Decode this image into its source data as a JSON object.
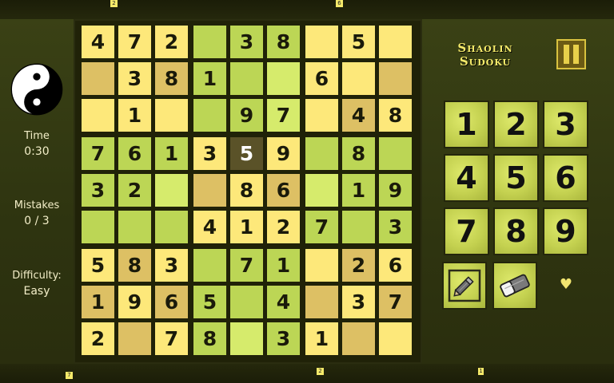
{
  "title_lines": [
    "Shaolin",
    "Sudoku"
  ],
  "stats": {
    "time_label": "Time",
    "time_value": "0:30",
    "mistakes_label": "Mistakes",
    "mistakes_value": "0 / 3",
    "difficulty_label": "Difficulty:",
    "difficulty_value": "Easy"
  },
  "selected_cell": [
    3,
    4
  ],
  "grid": [
    [
      "4",
      "7",
      "2",
      "",
      "3",
      "8",
      "",
      "5",
      ""
    ],
    [
      "",
      "3",
      "8",
      "1",
      "",
      "",
      "6",
      "",
      ""
    ],
    [
      "",
      "1",
      "",
      "",
      "9",
      "7",
      "",
      "4",
      "8"
    ],
    [
      "7",
      "6",
      "1",
      "3",
      "5",
      "9",
      "",
      "8",
      ""
    ],
    [
      "3",
      "2",
      "",
      "",
      "8",
      "6",
      "",
      "1",
      "9"
    ],
    [
      "",
      "",
      "",
      "4",
      "1",
      "2",
      "7",
      "",
      "3"
    ],
    [
      "5",
      "8",
      "3",
      "",
      "7",
      "1",
      "",
      "2",
      "6"
    ],
    [
      "1",
      "9",
      "6",
      "5",
      "",
      "4",
      "",
      "3",
      "7"
    ],
    [
      "2",
      "",
      "7",
      "8",
      "",
      "3",
      "1",
      "",
      ""
    ]
  ],
  "number_pad": [
    "1",
    "2",
    "3",
    "4",
    "5",
    "6",
    "7",
    "8",
    "9"
  ],
  "edge_ticks": {
    "top": [
      "2",
      "6"
    ],
    "bottom": [
      "7",
      "2",
      "1"
    ]
  },
  "colors": {
    "yellow_light": "#fde87a",
    "yellow_dark": "#efd04e",
    "green_light": "#d6eb6c",
    "green_dark": "#bcd655",
    "tan": "#ddc064",
    "selected": "#5a5228",
    "accent_title": "#f5ea6a"
  },
  "icons": {
    "logo": "yin-yang-icon",
    "pause": "pause-icon",
    "pencil": "pencil-icon",
    "eraser": "eraser-icon",
    "favorite": "heart-icon"
  }
}
